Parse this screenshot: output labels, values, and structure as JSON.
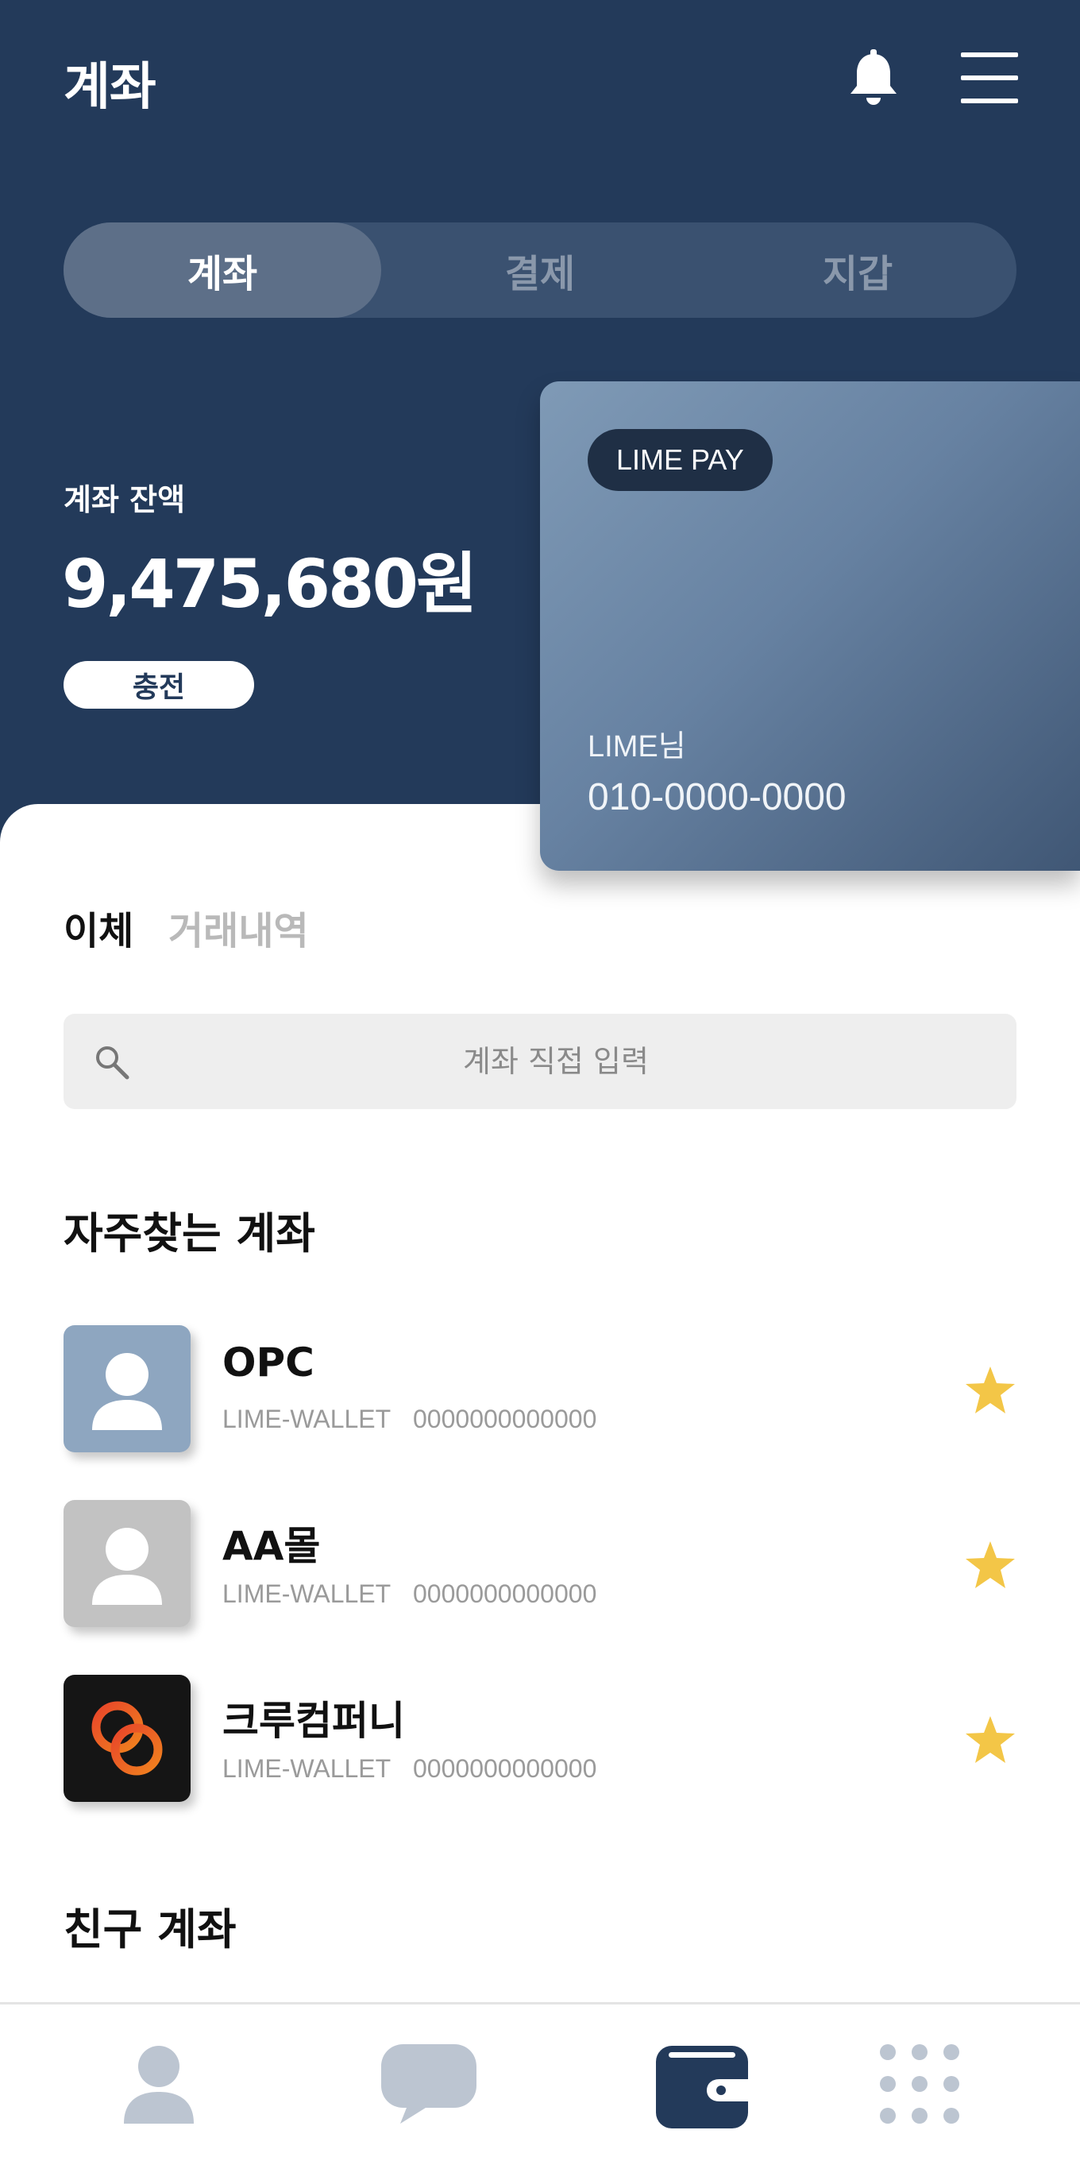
{
  "header": {
    "title": "계좌",
    "notification_icon": "bell-icon",
    "menu_icon": "hamburger-menu-icon"
  },
  "segment_tabs": [
    {
      "label": "계좌",
      "active": true
    },
    {
      "label": "결제",
      "active": false
    },
    {
      "label": "지갑",
      "active": false
    }
  ],
  "balance": {
    "label": "계좌 잔액",
    "amount": "9,475,680원",
    "charge_label": "충전"
  },
  "card": {
    "badge": "LIME PAY",
    "holder": "LIME님",
    "phone": "010-0000-0000"
  },
  "sub_tabs": {
    "transfer": "이체",
    "history": "거래내역"
  },
  "search": {
    "placeholder": "계좌 직접 입력"
  },
  "favorites": {
    "title": "자주찾는 계좌",
    "items": [
      {
        "name": "OPC",
        "bank": "LIME-WALLET",
        "account": "0000000000000",
        "avatar": "person-icon",
        "avatar_color": "#8ea6c0"
      },
      {
        "name": "AA몰",
        "bank": "LIME-WALLET",
        "account": "0000000000000",
        "avatar": "person-icon",
        "avatar_color": "#c2c2c2"
      },
      {
        "name": "크루컴퍼니",
        "bank": "LIME-WALLET",
        "account": "0000000000000",
        "avatar": "linked-rings-logo",
        "avatar_color": "#151515"
      }
    ]
  },
  "friends": {
    "title": "친구 계좌"
  },
  "bottom_nav": [
    {
      "icon": "person-icon",
      "active": false
    },
    {
      "icon": "chat-bubble-icon",
      "active": false
    },
    {
      "icon": "wallet-icon",
      "active": true
    },
    {
      "icon": "grid-dots-icon",
      "active": false
    }
  ],
  "colors": {
    "header_bg": "#233a5a",
    "star": "#f3c647",
    "inactive_icon": "#bcc5d1",
    "active_icon": "#233a5a"
  }
}
